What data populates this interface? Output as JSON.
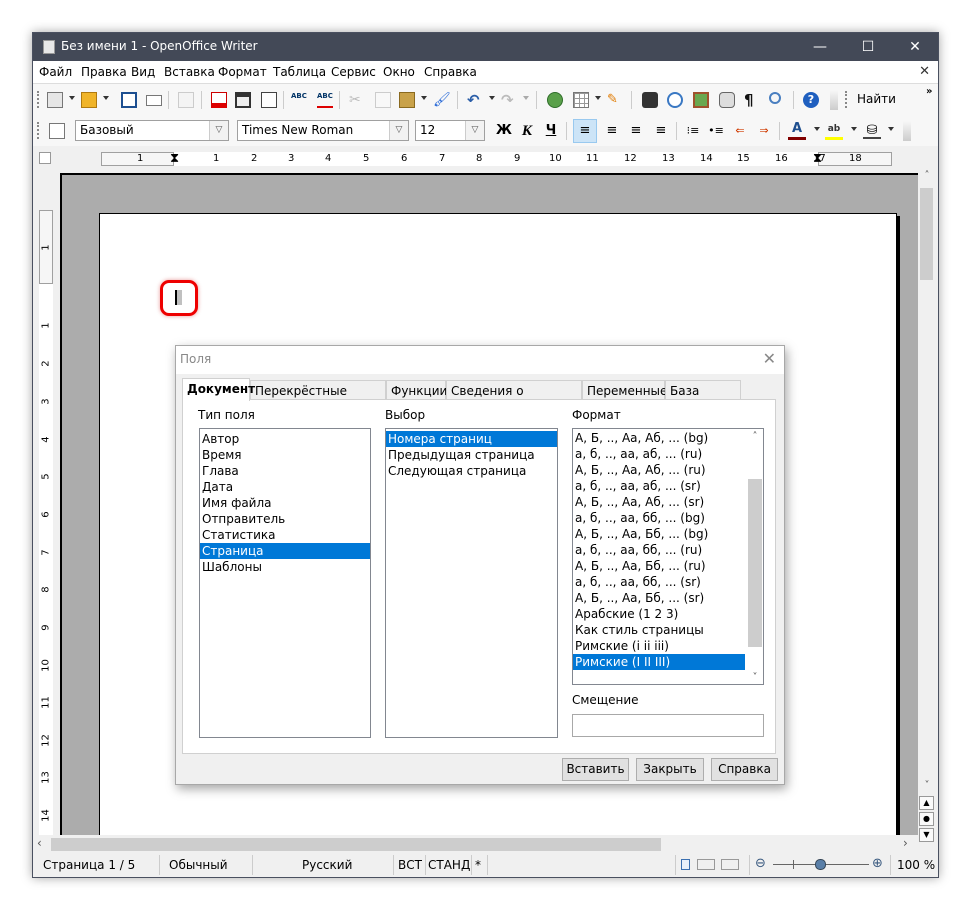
{
  "window": {
    "title": "Без имени 1 - OpenOffice Writer",
    "controls": {
      "minimize": "—",
      "maximize": "☐",
      "close": "✕"
    }
  },
  "menu": {
    "items": [
      "Файл",
      "Правка",
      "Вид",
      "Вставка",
      "Формат",
      "Таблица",
      "Сервис",
      "Окно",
      "Справка"
    ],
    "close_doc": "✕"
  },
  "toolbar_standard": {
    "icons": [
      "new-document",
      "open-folder",
      "save",
      "email",
      "edit-mode",
      "export-pdf",
      "print",
      "page-preview",
      "spellcheck",
      "autospellcheck",
      "cut",
      "copy",
      "paste",
      "clone-formatting",
      "undo",
      "redo",
      "hyperlink",
      "table",
      "draw-functions",
      "find-replace",
      "navigator",
      "gallery",
      "data-sources",
      "formatting-marks",
      "zoom",
      "help"
    ],
    "find_label": "Найти",
    "overflow": "»"
  },
  "toolbar_formatting": {
    "style_value": "Базовый",
    "font_value": "Times New Roman",
    "size_value": "12",
    "bold": "Ж",
    "italic": "К",
    "underline": "Ч",
    "align_left_active": true,
    "font_color": "#800000",
    "highlight_color": "#ffff00"
  },
  "ruler": {
    "horizontal_ticks": [
      "1",
      "1",
      "2",
      "3",
      "4",
      "5",
      "6",
      "7",
      "8",
      "9",
      "10",
      "11",
      "12",
      "13",
      "14",
      "15",
      "16",
      "17",
      "18"
    ],
    "vertical_ticks": [
      "1",
      "1",
      "2",
      "3",
      "4",
      "5",
      "6",
      "7",
      "8",
      "9",
      "10",
      "11",
      "12",
      "13",
      "14"
    ]
  },
  "dialog": {
    "title": "Поля",
    "close": "✕",
    "tabs": [
      "Документ",
      "Перекрёстные ссылки",
      "Функции",
      "Сведения о документе",
      "Переменные",
      "База данных"
    ],
    "active_tab": "Документ",
    "field_type_label": "Тип поля",
    "field_types": [
      "Автор",
      "Время",
      "Глава",
      "Дата",
      "Имя файла",
      "Отправитель",
      "Статистика",
      "Страница",
      "Шаблоны"
    ],
    "field_type_selected": "Страница",
    "select_label": "Выбор",
    "select_items": [
      "Номера страниц",
      "Предыдущая страница",
      "Следующая страница"
    ],
    "select_selected": "Номера страниц",
    "format_label": "Формат",
    "format_items": [
      "А, Б, .., Аа, Аб, ... (bg)",
      "а, б, .., аа, аб, ... (ru)",
      "А, Б, .., Аа, Аб, ... (ru)",
      "а, б, .., аа, аб, ... (sr)",
      "А, Б, .., Аа, Аб, ... (sr)",
      "а, б, .., аа, бб, ... (bg)",
      "А, Б, .., Аа, Бб, ... (bg)",
      "а, б, .., аа, бб, ... (ru)",
      "А, Б, .., Аа, Бб, ... (ru)",
      "а, б, .., аа, бб, ... (sr)",
      "А, Б, .., Аа, Бб, ... (sr)",
      "Арабские (1 2 3)",
      "Как стиль страницы",
      "Римские (i ii iii)",
      "Римские (I II III)"
    ],
    "format_selected": "Римские (I II III)",
    "offset_label": "Смещение",
    "offset_value": "",
    "buttons": {
      "insert": "Вставить",
      "close": "Закрыть",
      "help": "Справка"
    }
  },
  "statusbar": {
    "page": "Страница  1 / 5",
    "style": "Обычный",
    "language": "Русский",
    "insert_mode": "ВСТ",
    "selection_mode": "СТАНД",
    "modified": "*",
    "zoom": "100 %",
    "zoom_slider_percent": 100
  },
  "colors": {
    "titlebar": "#434957",
    "selection": "#0078d7",
    "highlight_box": "#e00000"
  }
}
